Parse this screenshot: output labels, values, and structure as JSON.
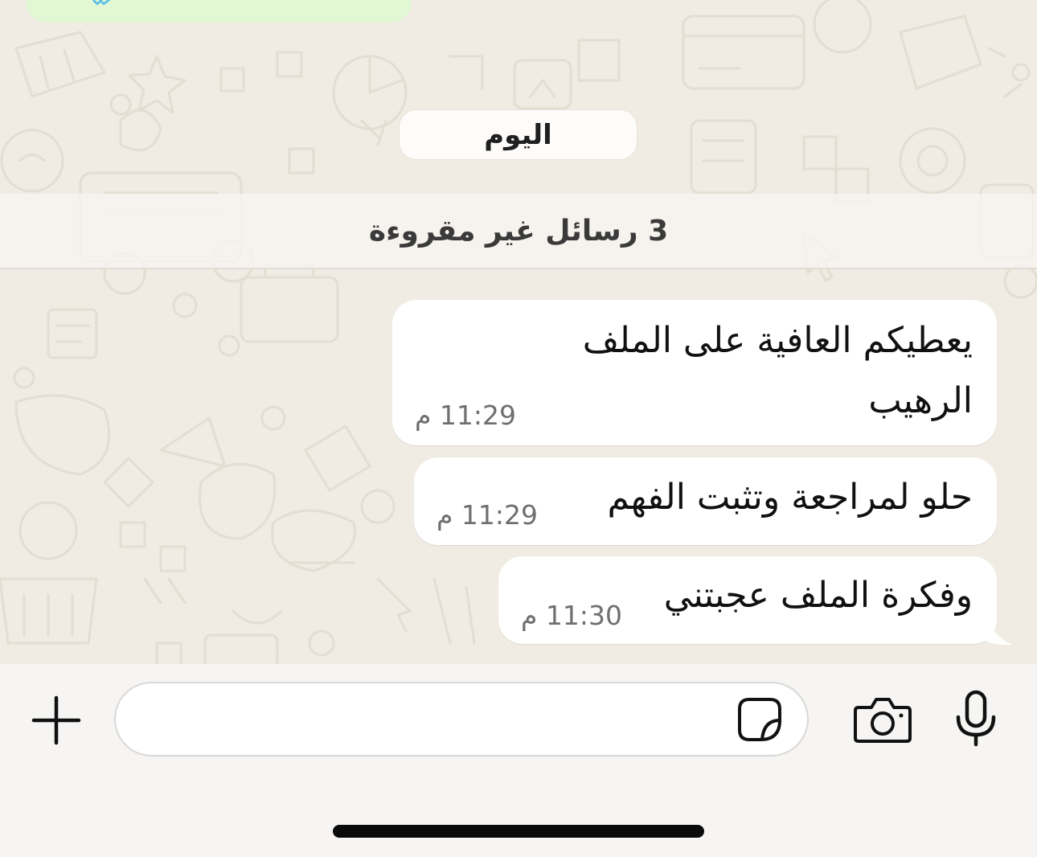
{
  "chat": {
    "date_separator": "اليوم",
    "unread_banner": "3 رسائل غير مقروءة",
    "messages": [
      {
        "lines": [
          "يعطيكم العافية على الملف",
          "الرهيب"
        ],
        "time": "11:29 م"
      },
      {
        "lines": [
          "حلو لمراجعة وتثبت الفهم"
        ],
        "time": "11:29 م"
      },
      {
        "lines": [
          "وفكرة الملف عجبتني"
        ],
        "time": "11:30 م"
      }
    ]
  },
  "composer": {
    "placeholder": "",
    "icons": {
      "add": "plus-icon",
      "sticker": "sticker-icon",
      "camera": "camera-icon",
      "mic": "microphone-icon"
    }
  },
  "colors": {
    "chat_background": "#f0ebe3",
    "incoming_bubble": "#ffffff",
    "outgoing_bubble": "#e2f7d4",
    "read_ticks": "#53bdeb"
  }
}
